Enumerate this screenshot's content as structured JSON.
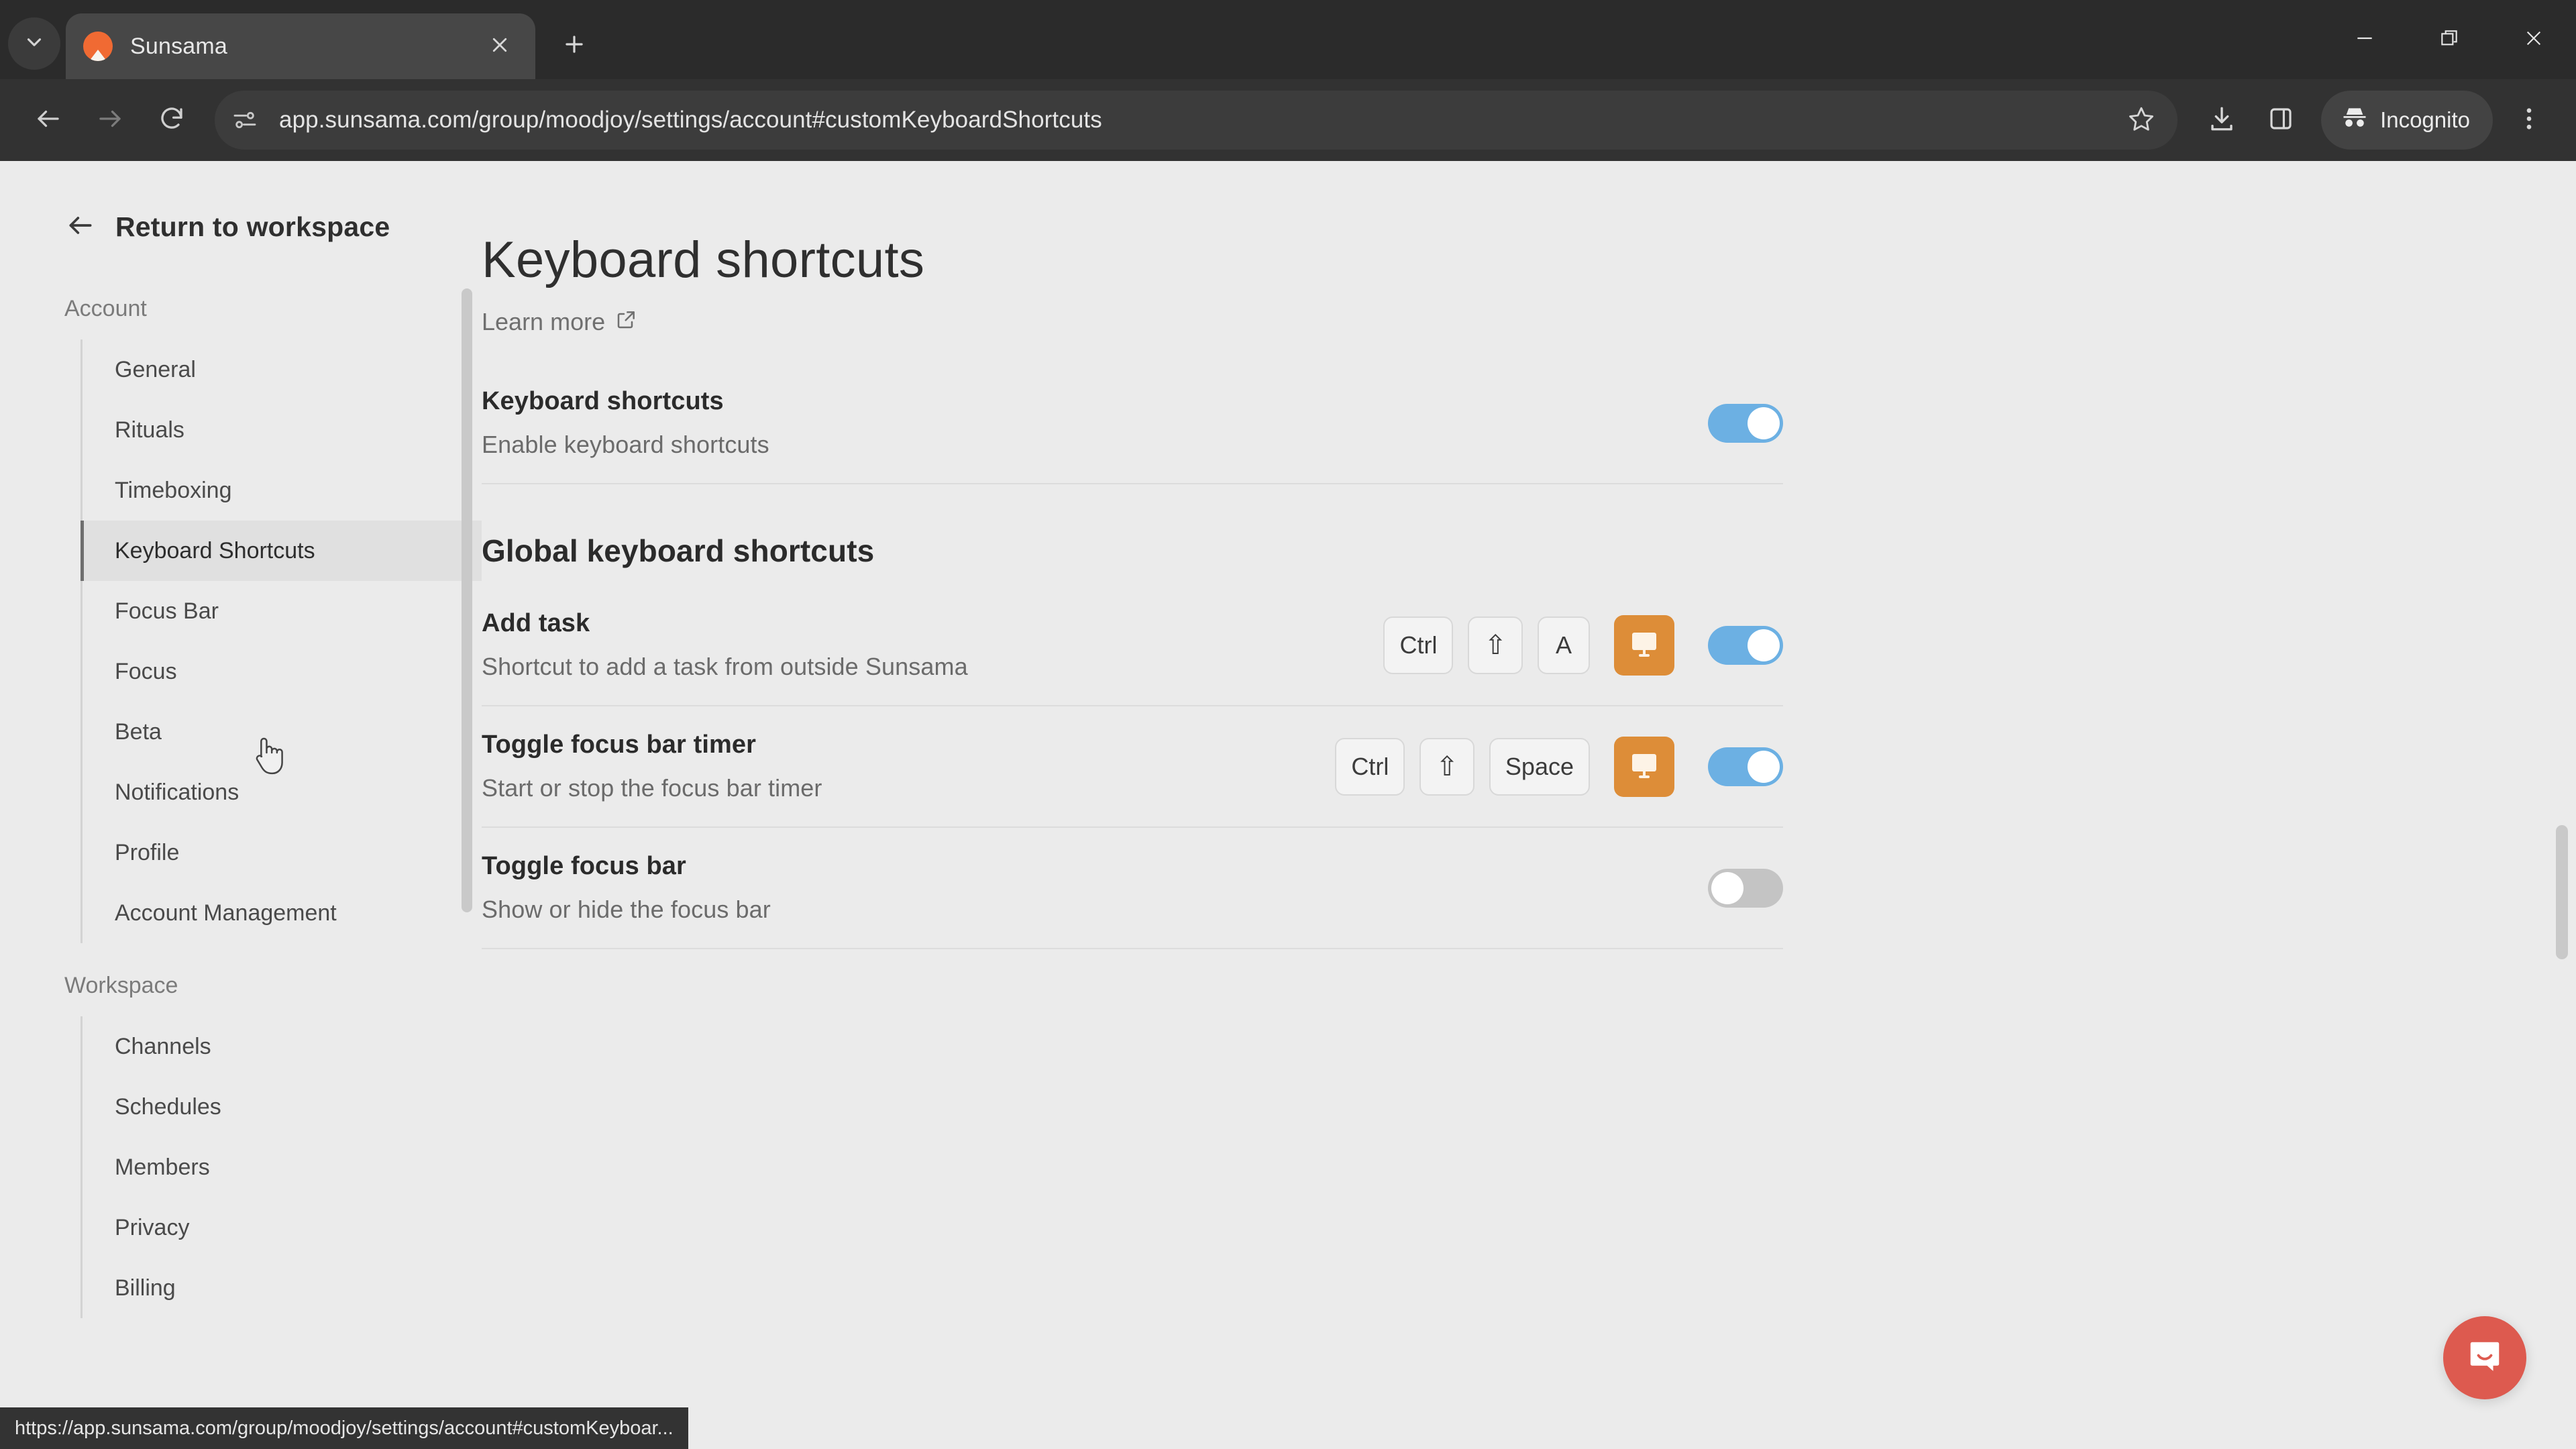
{
  "browser": {
    "tab": {
      "title": "Sunsama",
      "favicon": "sunsama-logo-icon"
    },
    "tab_list_icon": "chevron-down-icon",
    "new_tab_icon": "plus-icon",
    "close_tab_icon": "close-icon",
    "window_controls": {
      "minimize": "minimize-icon",
      "maximize": "restore-icon",
      "close": "close-icon"
    },
    "nav": {
      "back_icon": "arrow-left-icon",
      "forward_icon": "arrow-right-icon",
      "reload_icon": "reload-icon"
    },
    "omnibox": {
      "site_info_icon": "site-settings-icon",
      "url": "app.sunsama.com/group/moodjoy/settings/account#customKeyboardShortcuts",
      "bookmark_icon": "star-icon"
    },
    "toolbar_icons": {
      "downloads": "download-icon",
      "side_panel": "side-panel-icon",
      "menu": "three-dot-menu-icon"
    },
    "incognito": {
      "label": "Incognito",
      "icon": "incognito-icon"
    },
    "status_bar_url": "https://app.sunsama.com/group/moodjoy/settings/account#customKeyboar..."
  },
  "sidebar": {
    "return": {
      "label": "Return to workspace",
      "icon": "arrow-left-icon"
    },
    "groups": [
      {
        "title": "Account",
        "items": [
          {
            "label": "General",
            "active": false
          },
          {
            "label": "Rituals",
            "active": false
          },
          {
            "label": "Timeboxing",
            "active": false
          },
          {
            "label": "Keyboard Shortcuts",
            "active": true
          },
          {
            "label": "Focus Bar",
            "active": false
          },
          {
            "label": "Focus",
            "active": false
          },
          {
            "label": "Beta",
            "active": false
          },
          {
            "label": "Notifications",
            "active": false
          },
          {
            "label": "Profile",
            "active": false
          },
          {
            "label": "Account Management",
            "active": false
          }
        ]
      },
      {
        "title": "Workspace",
        "items": [
          {
            "label": "Channels",
            "active": false
          },
          {
            "label": "Schedules",
            "active": false
          },
          {
            "label": "Members",
            "active": false
          },
          {
            "label": "Privacy",
            "active": false
          },
          {
            "label": "Billing",
            "active": false
          }
        ]
      }
    ]
  },
  "main": {
    "title": "Keyboard shortcuts",
    "learn_more": {
      "label": "Learn more",
      "icon": "external-link-icon"
    },
    "enable_row": {
      "title": "Keyboard shortcuts",
      "subtitle": "Enable keyboard shortcuts",
      "toggle_on": true
    },
    "global_section_heading": "Global keyboard shortcuts",
    "shortcuts": [
      {
        "title": "Add task",
        "subtitle": "Shortcut to add a task from outside Sunsama",
        "keys": [
          "Ctrl",
          "⇧",
          "A"
        ],
        "platform_icon": "desktop-monitor-icon",
        "toggle_on": true
      },
      {
        "title": "Toggle focus bar timer",
        "subtitle": "Start or stop the focus bar timer",
        "keys": [
          "Ctrl",
          "⇧",
          "Space"
        ],
        "platform_icon": "desktop-monitor-icon",
        "toggle_on": true
      },
      {
        "title": "Toggle focus bar",
        "subtitle": "Show or hide the focus bar",
        "keys": [],
        "platform_icon": null,
        "toggle_on": false
      }
    ],
    "help_bubble_icon": "intercom-chat-icon"
  },
  "colors": {
    "accent_toggle_on": "#6cb0e3",
    "toggle_off": "#c4c4c4",
    "platform_chip": "#dd8d38",
    "intercom": "#dd5a4f",
    "page_bg": "#ebebeb",
    "chrome_bg": "#323232"
  }
}
